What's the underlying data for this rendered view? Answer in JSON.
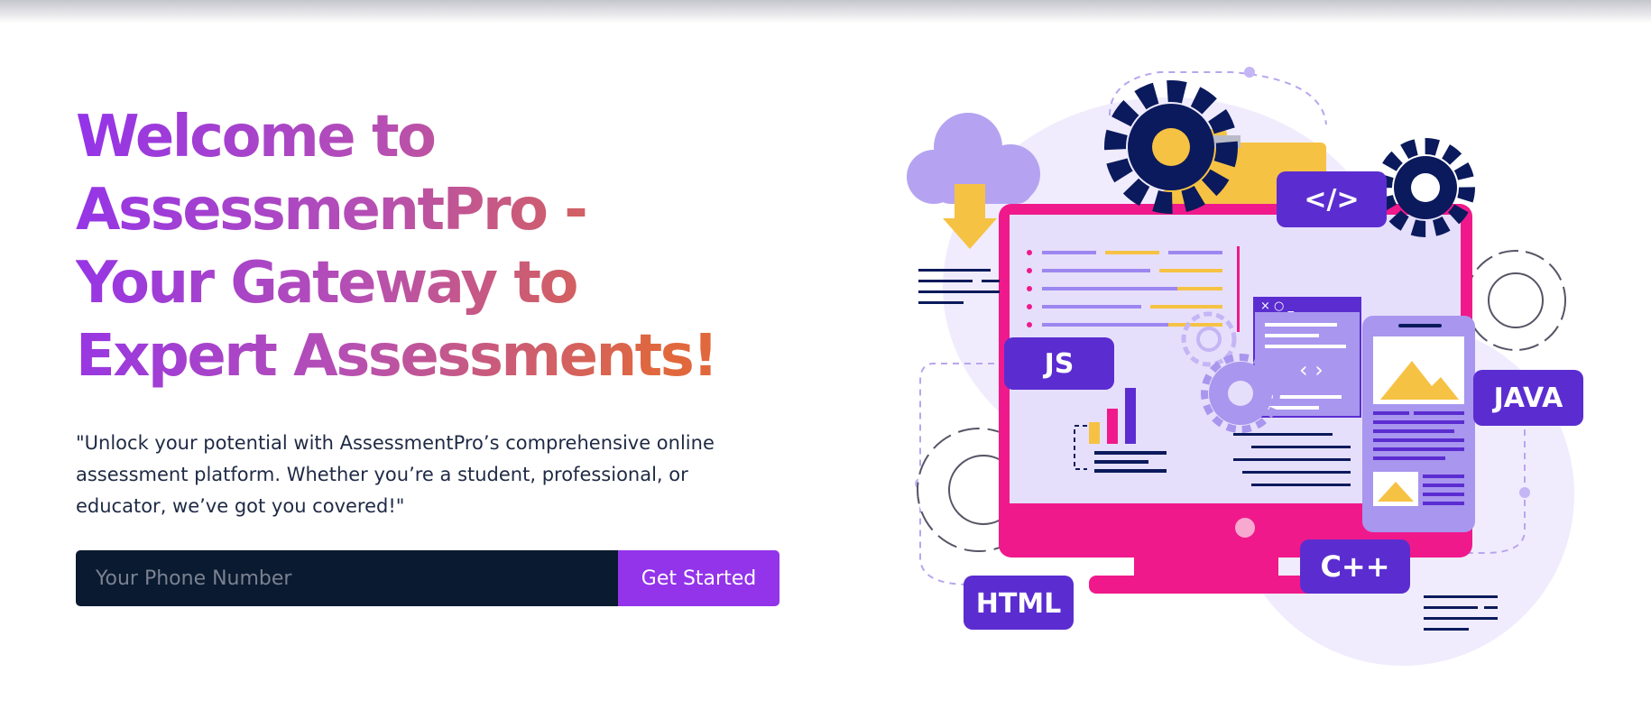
{
  "hero": {
    "title": "Welcome to AssessmentPro - Your Gateway to Expert Assessments!",
    "subtitle": "\"Unlock your potential with AssessmentPro’s comprehensive online assessment platform. Whether you’re a student, professional, or educator, we’ve got you covered!\""
  },
  "signup": {
    "phone_placeholder": "Your Phone Number",
    "button_label": "Get Started"
  },
  "illustration": {
    "badges": {
      "code": "</>",
      "js": "JS",
      "java": "JAVA",
      "html": "HTML",
      "cpp": "C++"
    },
    "window_controls": "× ○ _"
  },
  "colors": {
    "brand_purple": "#9333ea",
    "gradient_end": "#e0683c",
    "input_bg": "#0a1a30",
    "monitor_pink": "#f0198c",
    "navy": "#0b1a5c",
    "badge_purple": "#5b2dd0",
    "folder_yellow": "#f6c244"
  }
}
